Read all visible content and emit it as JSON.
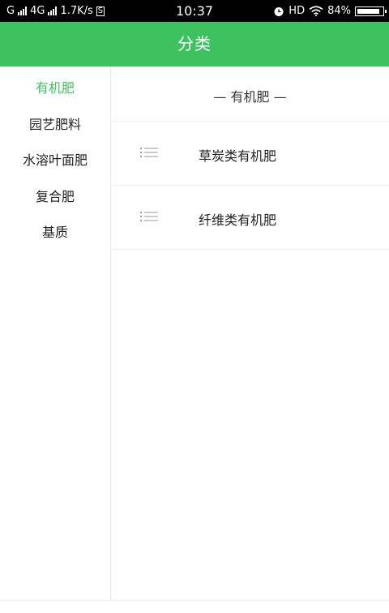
{
  "status_bar": {
    "carrier": "G",
    "network": "4G",
    "speed": "1.7K/s",
    "sim_badge": "S",
    "time": "10:37",
    "hd": "HD",
    "battery": "84%"
  },
  "header": {
    "title": "分类"
  },
  "sidebar": {
    "items": [
      {
        "label": "有机肥"
      },
      {
        "label": "园艺肥料"
      },
      {
        "label": "水溶叶面肥"
      },
      {
        "label": "复合肥"
      },
      {
        "label": "基质"
      }
    ]
  },
  "main": {
    "section_title": "— 有机肥 —",
    "items": [
      {
        "label": "草炭类有机肥"
      },
      {
        "label": "纤维类有机肥"
      }
    ]
  },
  "colors": {
    "accent": "#3ec25f"
  }
}
